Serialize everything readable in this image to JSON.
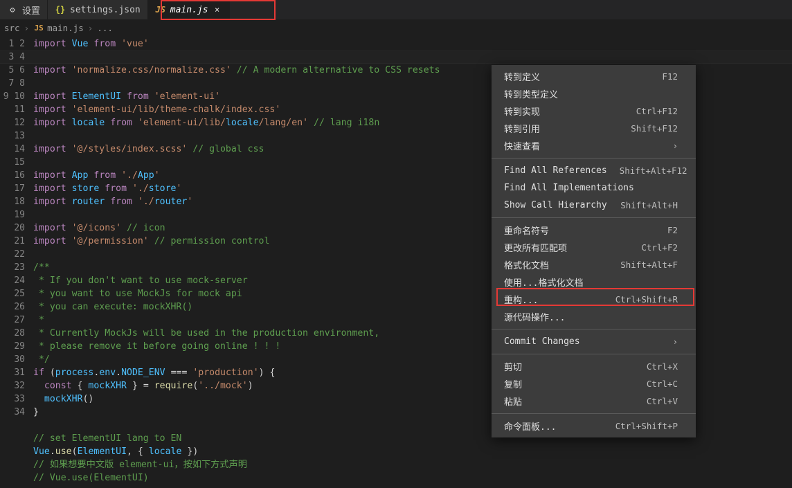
{
  "tabs": [
    {
      "icon": "gear",
      "label": "设置"
    },
    {
      "icon": "json",
      "label": "settings.json"
    },
    {
      "icon": "js",
      "label": "main.js",
      "active": true
    }
  ],
  "tab_close": "×",
  "breadcrumb": {
    "src": "src",
    "file": "main.js",
    "dots": "..."
  },
  "code_lines": [
    "import Vue from 'vue'",
    "",
    "import 'normalize.css/normalize.css' // A modern alternative to CSS resets",
    "",
    "import ElementUI from 'element-ui'",
    "import 'element-ui/lib/theme-chalk/index.css'",
    "import locale from 'element-ui/lib/locale/lang/en' // lang i18n",
    "",
    "import '@/styles/index.scss' // global css",
    "",
    "import App from './App'",
    "import store from './store'",
    "import router from './router'",
    "",
    "import '@/icons' // icon",
    "import '@/permission' // permission control",
    "",
    "/**",
    " * If you don't want to use mock-server",
    " * you want to use MockJs for mock api",
    " * you can execute: mockXHR()",
    " *",
    " * Currently MockJs will be used in the production environment,",
    " * please remove it before going online ! ! !",
    " */",
    "if (process.env.NODE_ENV === 'production') {",
    "  const { mockXHR } = require('../mock')",
    "  mockXHR()",
    "}",
    "",
    "// set ElementUI lang to EN",
    "Vue.use(ElementUI, { locale })",
    "// 如果想要中文版 element-ui，按如下方式声明",
    "// Vue.use(ElementUI)"
  ],
  "context_menu": [
    [
      {
        "label": "转到定义",
        "kbd": "F12"
      },
      {
        "label": "转到类型定义",
        "kbd": ""
      },
      {
        "label": "转到实现",
        "kbd": "Ctrl+F12"
      },
      {
        "label": "转到引用",
        "kbd": "Shift+F12"
      },
      {
        "label": "快速查看",
        "kbd": "",
        "submenu": true
      }
    ],
    [
      {
        "label": "Find All References",
        "kbd": "Shift+Alt+F12"
      },
      {
        "label": "Find All Implementations",
        "kbd": ""
      },
      {
        "label": "Show Call Hierarchy",
        "kbd": "Shift+Alt+H"
      }
    ],
    [
      {
        "label": "重命名符号",
        "kbd": "F2"
      },
      {
        "label": "更改所有匹配项",
        "kbd": "Ctrl+F2"
      },
      {
        "label": "格式化文档",
        "kbd": "Shift+Alt+F"
      },
      {
        "label": "使用...格式化文档",
        "kbd": ""
      },
      {
        "label": "重构...",
        "kbd": "Ctrl+Shift+R"
      },
      {
        "label": "源代码操作...",
        "kbd": ""
      }
    ],
    [
      {
        "label": "Commit Changes",
        "kbd": "",
        "submenu": true
      }
    ],
    [
      {
        "label": "剪切",
        "kbd": "Ctrl+X"
      },
      {
        "label": "复制",
        "kbd": "Ctrl+C"
      },
      {
        "label": "粘贴",
        "kbd": "Ctrl+V"
      }
    ],
    [
      {
        "label": "命令面板...",
        "kbd": "Ctrl+Shift+P"
      }
    ]
  ]
}
